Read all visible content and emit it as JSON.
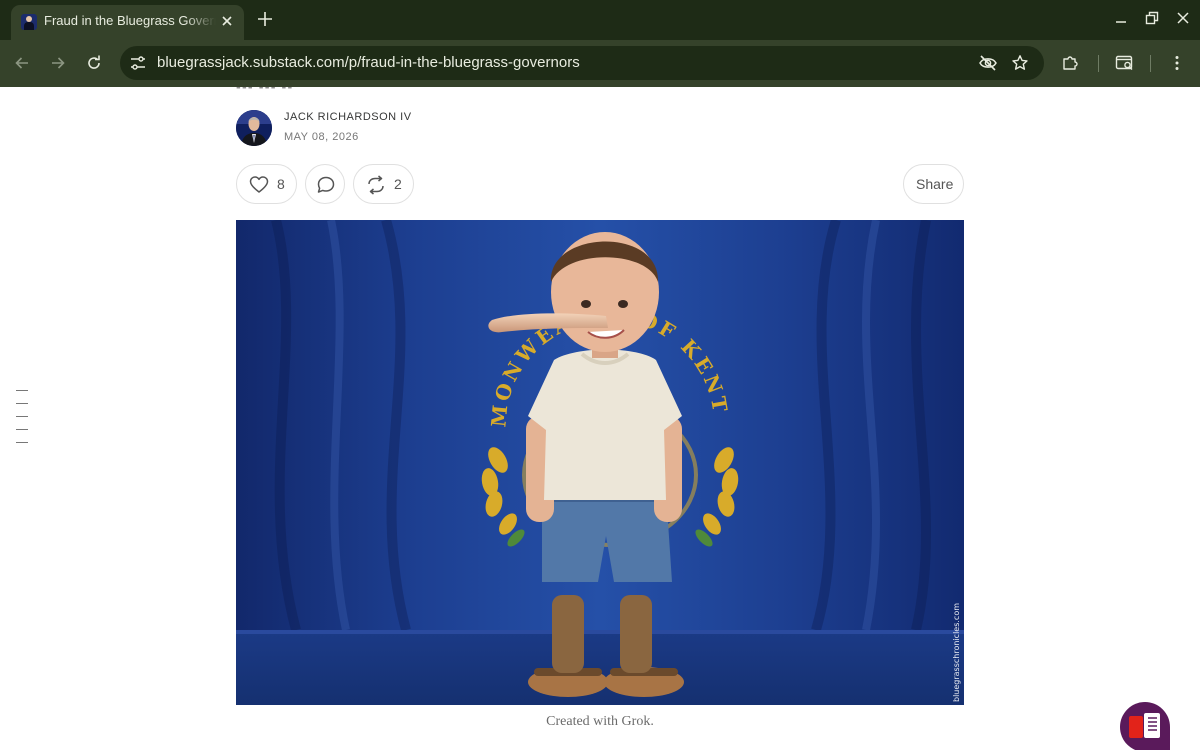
{
  "browser": {
    "tab_title": "Fraud in the Bluegrass Governors",
    "url": "bluegrassjack.substack.com/p/fraud-in-the-bluegrass-governors",
    "icons": [
      "back-icon",
      "forward-icon",
      "reload-icon",
      "site-info-icon",
      "eye-off-icon",
      "star-icon",
      "extensions-icon",
      "reading-mode-icon",
      "menu-icon",
      "new-tab-icon",
      "minimize-icon",
      "restore-icon",
      "close-window-icon"
    ]
  },
  "post": {
    "author": "JACK RICHARDSON IV",
    "date": "MAY 08, 2026",
    "likes": "8",
    "restacks": "2",
    "share_label": "Share"
  },
  "image": {
    "seal_text": "COMMONWEALTH OF KENTUCKY",
    "watermark": "bluegrasschronicles.com",
    "caption": "Created with Grok."
  },
  "colors": {
    "chrome_dark": "#1e2b16",
    "chrome_toolbar": "#35422a",
    "flag_blue": "#1d3f91",
    "seal_gold": "#d8ab2a",
    "reader_purple": "#5a1a5b"
  }
}
